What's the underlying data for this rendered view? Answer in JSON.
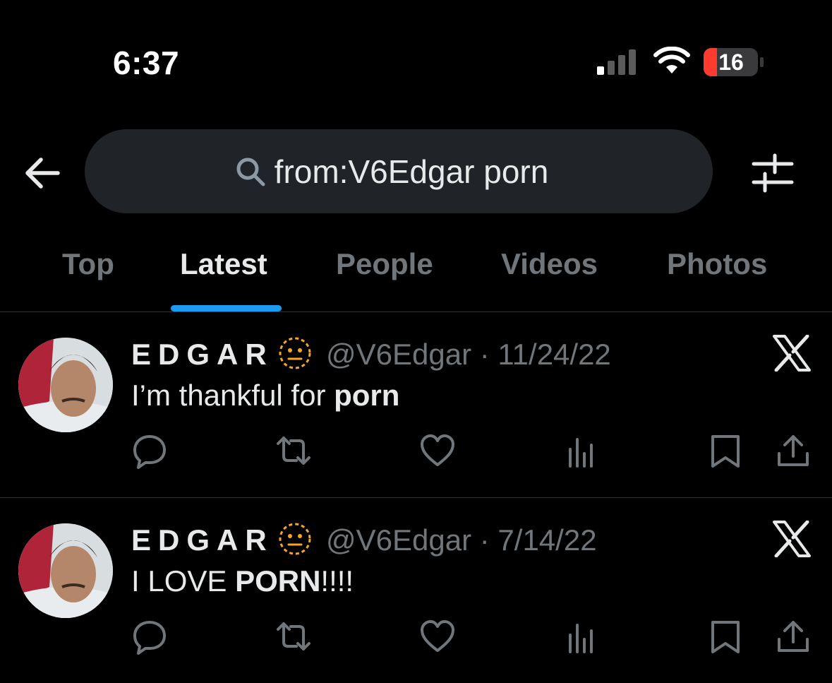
{
  "status_bar": {
    "time": "6:37",
    "battery_level": "16"
  },
  "search": {
    "query": "from:V6Edgar porn"
  },
  "tabs": [
    {
      "label": "Top",
      "active": false
    },
    {
      "label": "Latest",
      "active": true
    },
    {
      "label": "People",
      "active": false
    },
    {
      "label": "Videos",
      "active": false
    },
    {
      "label": "Photos",
      "active": false
    }
  ],
  "tweets": [
    {
      "name": "EDGAR",
      "handle": "@V6Edgar",
      "separator": " · ",
      "date": "11/24/22",
      "text_plain": "I’m thankful for ",
      "text_bold": "porn",
      "text_after": ""
    },
    {
      "name": "EDGAR",
      "handle": "@V6Edgar",
      "separator": " · ",
      "date": "7/14/22",
      "text_plain": "I LOVE ",
      "text_bold": "PORN",
      "text_after": "!!!!"
    }
  ],
  "icons": {
    "back": "back-arrow-icon",
    "search": "search-icon",
    "filter": "filter-sliders-icon",
    "emoji": "dotted-line-face-emoji",
    "source": "x-logo-icon",
    "actions": [
      "reply-icon",
      "retweet-icon",
      "like-icon",
      "views-icon",
      "bookmark-icon",
      "share-icon"
    ]
  },
  "colors": {
    "background": "#000000",
    "accent": "#1d9bf0",
    "muted_text": "#71767b",
    "battery_low": "#ff3b30"
  }
}
